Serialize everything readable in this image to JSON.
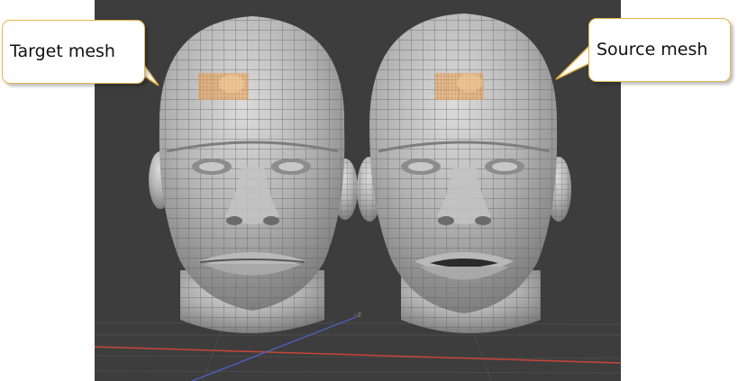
{
  "labels": {
    "target": "Target mesh",
    "source": "Source mesh"
  },
  "viewport": {
    "axis_label": "-z"
  },
  "colors": {
    "viewport_bg": "#3d3d3d",
    "grid": "#4b4b4b",
    "x_axis": "#c9453a",
    "z_axis": "#4e5fc6",
    "mesh": "#a9a9a9",
    "wire": "#5e5e5e",
    "selection": "#e8a35a",
    "callout_border": "#e7b44a"
  }
}
